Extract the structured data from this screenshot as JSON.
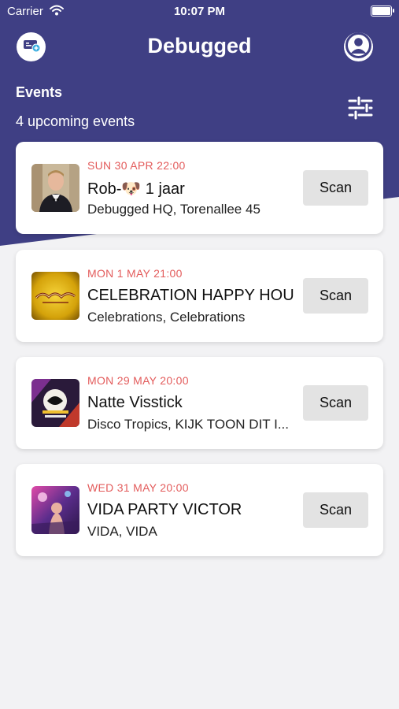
{
  "status_bar": {
    "carrier": "Carrier",
    "time": "10:07 PM"
  },
  "header": {
    "title": "Debugged"
  },
  "events_section": {
    "title": "Events",
    "subtitle": "4 upcoming events"
  },
  "events": [
    {
      "date": "SUN 30 APR 22:00",
      "name": "Rob-🐶 1 jaar",
      "venue": "Debugged HQ, Torenallee 45",
      "action": "Scan"
    },
    {
      "date": "MON 1 MAY 21:00",
      "name": "CELEBRATION HAPPY HOUR",
      "venue": "Celebrations, Celebrations",
      "action": "Scan"
    },
    {
      "date": "MON 29 MAY 20:00",
      "name": "Natte Visstick",
      "venue": "Disco Tropics, KIJK TOON DIT I...",
      "action": "Scan"
    },
    {
      "date": "WED 31 MAY 20:00",
      "name": "VIDA PARTY VICTOR",
      "venue": "VIDA, VIDA",
      "action": "Scan"
    }
  ],
  "colors": {
    "header": "#3f3f84",
    "accent_date": "#e35b5b",
    "background": "#f2f2f4"
  },
  "icons": {
    "ticket": "ticket-add-icon",
    "profile": "user-profile-icon",
    "filter": "sliders-filter-icon"
  }
}
